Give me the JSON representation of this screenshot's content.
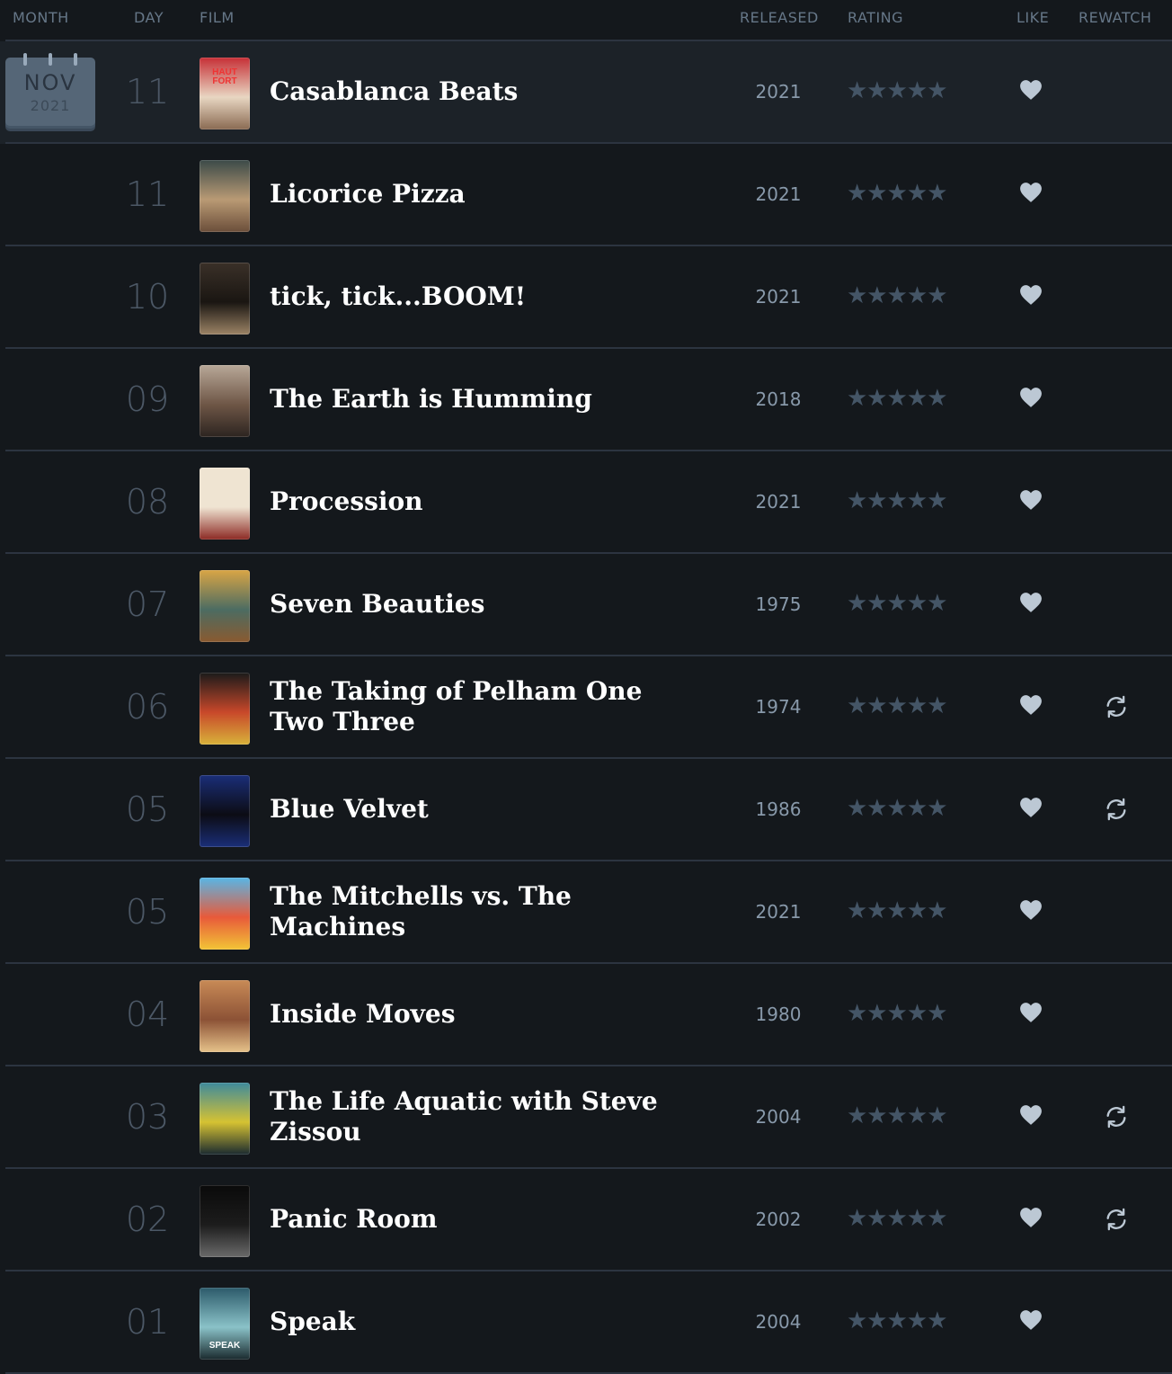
{
  "header": {
    "month": "MONTH",
    "day": "DAY",
    "film": "FILM",
    "released": "RELEASED",
    "rating": "RATING",
    "like": "LIKE",
    "rewatch": "REWATCH"
  },
  "calendar": {
    "month": "NOV",
    "year": "2021"
  },
  "rating_stars": "★★★★★",
  "colors": {
    "background": "#14181c",
    "row_highlight": "#1c2228",
    "icon": "#bcc8d4",
    "star": "#445566"
  },
  "entries": [
    {
      "day": "11",
      "title": "Casablanca Beats",
      "released": "2021",
      "liked": true,
      "rewatch": false,
      "poster_colors": [
        "#c62f36",
        "#e8d6c2",
        "#8a6a52"
      ],
      "poster_text": "HAUT FORT"
    },
    {
      "day": "11",
      "title": "Licorice Pizza",
      "released": "2021",
      "liked": true,
      "rewatch": false,
      "poster_colors": [
        "#3b4a48",
        "#b99a74",
        "#6b4e3a"
      ]
    },
    {
      "day": "10",
      "title": "tick, tick...BOOM!",
      "released": "2021",
      "liked": true,
      "rewatch": false,
      "poster_colors": [
        "#3a3028",
        "#1a1612",
        "#9c8466"
      ]
    },
    {
      "day": "09",
      "title": "The Earth is Humming",
      "released": "2018",
      "liked": true,
      "rewatch": false,
      "poster_colors": [
        "#b8a898",
        "#6e5646",
        "#2c2420"
      ]
    },
    {
      "day": "08",
      "title": "Procession",
      "released": "2021",
      "liked": true,
      "rewatch": false,
      "poster_colors": [
        "#efe4d2",
        "#efe4d2",
        "#8c2a24"
      ]
    },
    {
      "day": "07",
      "title": "Seven Beauties",
      "released": "1975",
      "liked": true,
      "rewatch": false,
      "poster_colors": [
        "#d9a545",
        "#4c6c62",
        "#8a5a30"
      ]
    },
    {
      "day": "06",
      "title": "The Taking of Pelham One Two Three",
      "released": "1974",
      "liked": true,
      "rewatch": true,
      "poster_colors": [
        "#1a1a1a",
        "#c8482a",
        "#d8b23a"
      ]
    },
    {
      "day": "05",
      "title": "Blue Velvet",
      "released": "1986",
      "liked": true,
      "rewatch": true,
      "poster_colors": [
        "#1a2e78",
        "#0c0c14",
        "#1a2e78"
      ]
    },
    {
      "day": "05",
      "title": "The Mitchells vs. The Machines",
      "released": "2021",
      "liked": true,
      "rewatch": false,
      "poster_colors": [
        "#58b6e6",
        "#e85a3a",
        "#f2c436"
      ]
    },
    {
      "day": "04",
      "title": "Inside Moves",
      "released": "1980",
      "liked": true,
      "rewatch": false,
      "poster_colors": [
        "#c88a56",
        "#8c5236",
        "#e6c28a"
      ]
    },
    {
      "day": "03",
      "title": "The Life Aquatic with Steve Zissou",
      "released": "2004",
      "liked": true,
      "rewatch": true,
      "poster_colors": [
        "#3e8a9c",
        "#d6c232",
        "#1a2a30"
      ]
    },
    {
      "day": "02",
      "title": "Panic Room",
      "released": "2002",
      "liked": true,
      "rewatch": true,
      "poster_colors": [
        "#0a0a0a",
        "#1c1c1c",
        "#6a6a6a"
      ]
    },
    {
      "day": "01",
      "title": "Speak",
      "released": "2004",
      "liked": true,
      "rewatch": false,
      "poster_colors": [
        "#2c5a6a",
        "#8ac2c8",
        "#1a2a2e"
      ],
      "poster_text": "SPEAK"
    }
  ]
}
